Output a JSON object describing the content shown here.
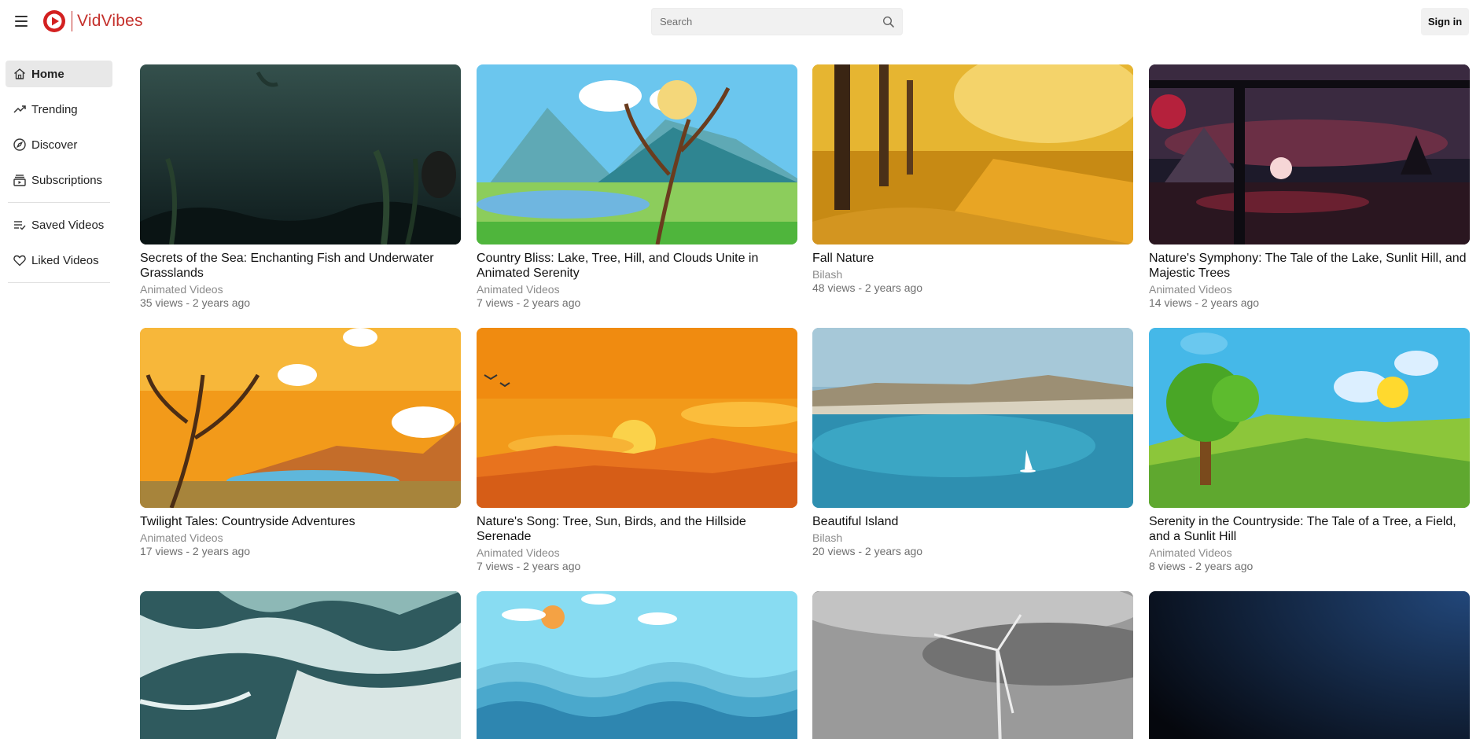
{
  "app": {
    "name": "VidVibes",
    "brand_color": "#c4302b"
  },
  "header": {
    "search_placeholder": "Search",
    "signin_label": "Sign in"
  },
  "sidebar": {
    "items": [
      {
        "label": "Home",
        "icon": "home-icon",
        "active": true
      },
      {
        "label": "Trending",
        "icon": "trending-icon"
      },
      {
        "label": "Discover",
        "icon": "compass-icon"
      },
      {
        "label": "Subscriptions",
        "icon": "subscriptions-icon"
      }
    ],
    "library": [
      {
        "label": "Saved Videos",
        "icon": "playlist-check-icon"
      },
      {
        "label": "Liked Videos",
        "icon": "heart-icon"
      }
    ]
  },
  "videos": [
    {
      "title": "Secrets of the Sea: Enchanting Fish and Underwater Grasslands",
      "channel": "Animated Videos",
      "meta": "35 views - 2 years ago",
      "thumb": "underwater"
    },
    {
      "title": "Country Bliss: Lake, Tree, Hill, and Clouds Unite in Animated Serenity",
      "channel": "Animated Videos",
      "meta": "7 views - 2 years ago",
      "thumb": "country-lake"
    },
    {
      "title": "Fall Nature",
      "channel": "Bilash",
      "meta": "48 views - 2 years ago",
      "thumb": "autumn-path"
    },
    {
      "title": "Nature's Symphony: The Tale of the Lake, Sunlit Hill, and Majestic Trees",
      "channel": "Animated Videos",
      "meta": "14 views - 2 years ago",
      "thumb": "night-lake"
    },
    {
      "title": "Twilight Tales: Countryside Adventures",
      "channel": "Animated Videos",
      "meta": "17 views - 2 years ago",
      "thumb": "twilight"
    },
    {
      "title": "Nature's Song: Tree, Sun, Birds, and the Hillside Serenade",
      "channel": "Animated Videos",
      "meta": "7 views - 2 years ago",
      "thumb": "sunset-hills"
    },
    {
      "title": "Beautiful Island",
      "channel": "Bilash",
      "meta": "20 views - 2 years ago",
      "thumb": "island"
    },
    {
      "title": "Serenity in the Countryside: The Tale of a Tree, a Field, and a Sunlit Hill",
      "channel": "Animated Videos",
      "meta": "8 views - 2 years ago",
      "thumb": "green-tree"
    },
    {
      "title": "",
      "channel": "",
      "meta": "",
      "thumb": "waves"
    },
    {
      "title": "",
      "channel": "",
      "meta": "",
      "thumb": "sea-cartoon"
    },
    {
      "title": "",
      "channel": "",
      "meta": "",
      "thumb": "wind-turbine"
    },
    {
      "title": "",
      "channel": "",
      "meta": "",
      "thumb": "dark-blue"
    }
  ]
}
